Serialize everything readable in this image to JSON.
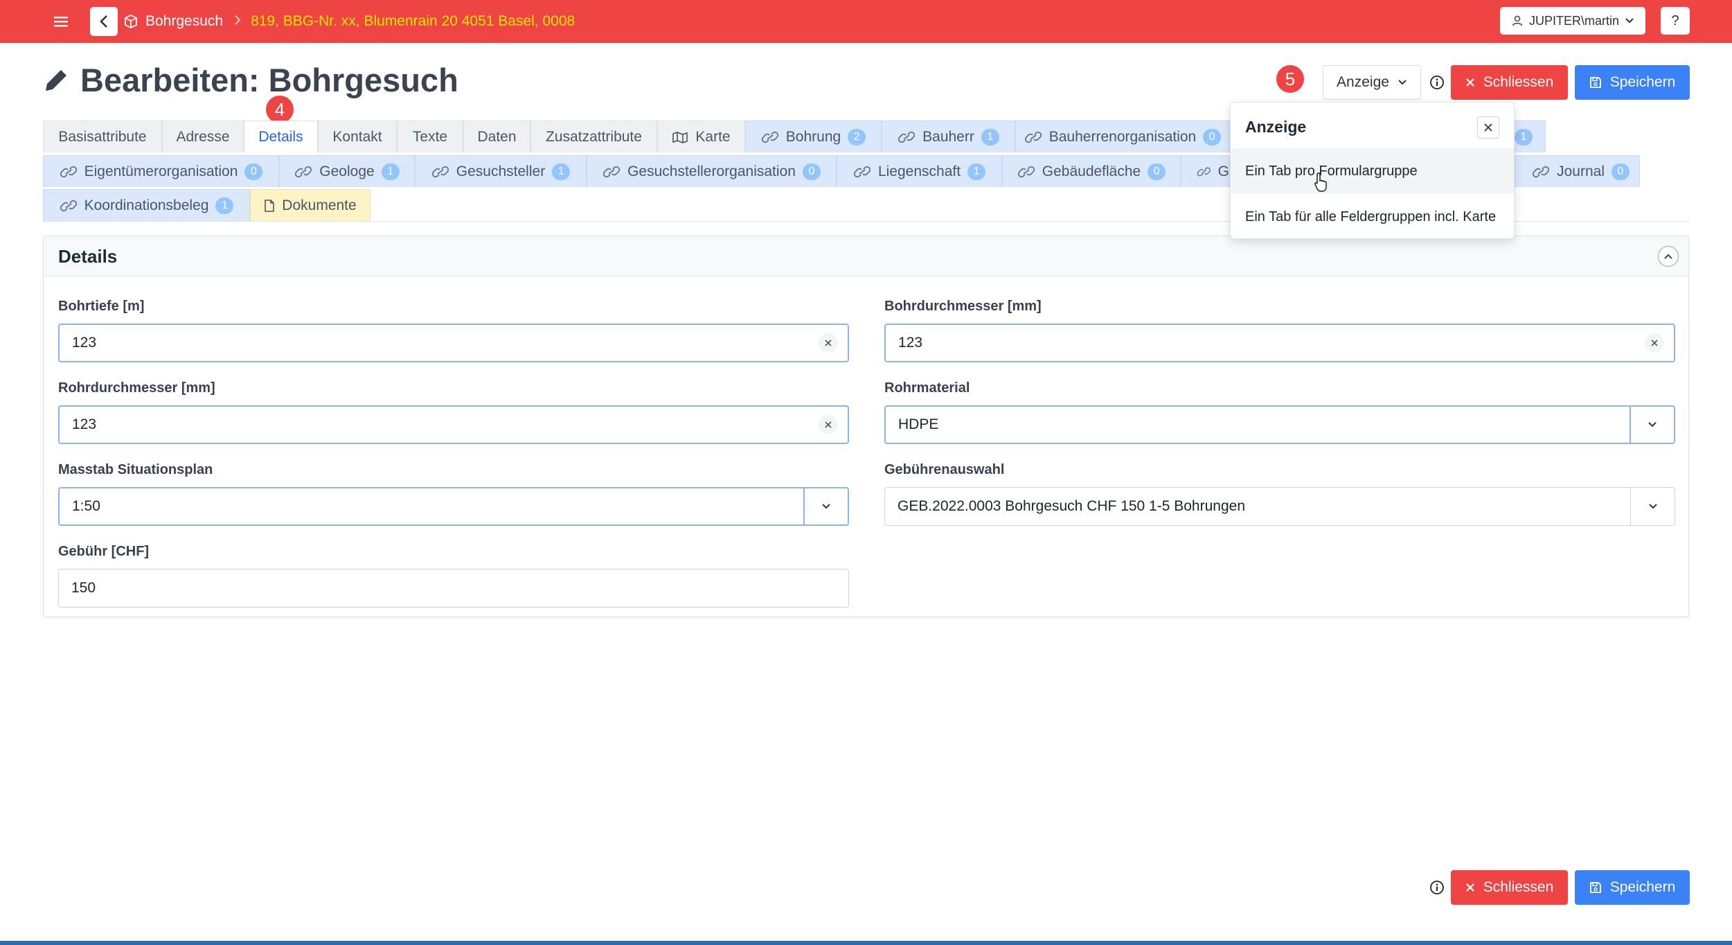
{
  "topbar": {
    "app_title": "Bohrgesuch",
    "record": "819, BBG-Nr. xx, Blumenrain 20 4051 Basel, 0008",
    "user": "JUPITER\\martin",
    "help": "?"
  },
  "page": {
    "title": "Bearbeiten: Bohrgesuch"
  },
  "steps": {
    "tab_step": "4",
    "anzeige_step": "5"
  },
  "actions": {
    "anzeige": "Anzeige",
    "close": "Schliessen",
    "save": "Speichern"
  },
  "tabs": {
    "row1": [
      {
        "label": "Basisattribute"
      },
      {
        "label": "Adresse"
      },
      {
        "label": "Details"
      },
      {
        "label": "Kontakt"
      },
      {
        "label": "Texte"
      },
      {
        "label": "Daten"
      },
      {
        "label": "Zusatzattribute"
      },
      {
        "label": "Karte"
      },
      {
        "label": "Bohrung",
        "count": "2"
      },
      {
        "label": "Bauherr",
        "count": "1"
      },
      {
        "label": "Bauherrenorganisation",
        "count": "0"
      },
      {
        "count": "1"
      }
    ],
    "row2": [
      {
        "label": "Eigentümerorganisation",
        "count": "0"
      },
      {
        "label": "Geologe",
        "count": "1"
      },
      {
        "label": "Gesuchsteller",
        "count": "1"
      },
      {
        "label": "Gesuchstellerorganisation",
        "count": "0"
      },
      {
        "label": "Liegenschaft",
        "count": "1"
      },
      {
        "label": "Gebäudefläche",
        "count": "0"
      },
      {
        "label": "G"
      },
      {
        "label": "Journal",
        "count": "0"
      }
    ],
    "row3": [
      {
        "label": "Koordinationsbeleg",
        "count": "1"
      },
      {
        "label": "Dokumente"
      }
    ]
  },
  "details": {
    "title": "Details",
    "fields": {
      "bohrtiefe": {
        "label": "Bohrtiefe [m]",
        "value": "123"
      },
      "bohrdurchmesser": {
        "label": "Bohrdurchmesser [mm]",
        "value": "123"
      },
      "rohrdurchmesser": {
        "label": "Rohrdurchmesser [mm]",
        "value": "123"
      },
      "rohrmaterial": {
        "label": "Rohrmaterial",
        "value": "HDPE"
      },
      "masstab": {
        "label": "Masstab Situationsplan",
        "value": "1:50"
      },
      "gebuehrenauswahl": {
        "label": "Gebührenauswahl",
        "value": "GEB.2022.0003 Bohrgesuch CHF 150 1-5 Bohrungen"
      },
      "gebuehr": {
        "label": "Gebühr [CHF]",
        "value": "150"
      }
    }
  },
  "anzeige_popover": {
    "title": "Anzeige",
    "options": [
      "Ein Tab pro Formulargruppe",
      "Ein Tab für alle Feldergruppen incl. Karte"
    ]
  },
  "colors": {
    "header": "#ef4444",
    "primary": "#3b82f6",
    "danger": "#ef4444",
    "link_tab": "#dbe8fb",
    "doc_tab": "#fdf3c4",
    "badge": "#93c5fd"
  },
  "icons": [
    "menu-icon",
    "chevron-left-icon",
    "cube-icon",
    "chevron-right-icon",
    "user-icon",
    "chevron-down-icon",
    "pencil-icon",
    "info-icon",
    "close-icon",
    "save-icon",
    "map-icon",
    "link-icon",
    "file-icon",
    "chevron-up-icon",
    "clear-icon",
    "pointer-cursor-icon"
  ]
}
